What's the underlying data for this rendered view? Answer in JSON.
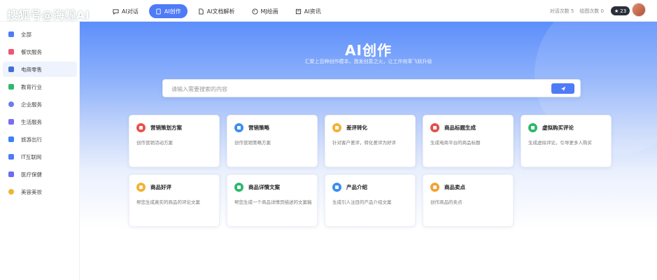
{
  "watermark": "搜狐号@海鲸AI",
  "nav": [
    {
      "label": "AI对话",
      "icon": "chat-bubble-icon"
    },
    {
      "label": "AI创作",
      "icon": "create-pad-icon",
      "active": true
    },
    {
      "label": "AI文档解析",
      "icon": "document-icon"
    },
    {
      "label": "MJ绘画",
      "icon": "palette-icon"
    },
    {
      "label": "AI资讯",
      "icon": "news-icon"
    }
  ],
  "counts": {
    "chat": "对话次数 5",
    "draw": "绘图次数 0"
  },
  "badge": "23",
  "sidebar": [
    {
      "label": "全部",
      "color": "#4e7bf6"
    },
    {
      "label": "餐饮服务",
      "color": "#f0546e"
    },
    {
      "label": "电商零售",
      "color": "#3f6fd6",
      "active": true
    },
    {
      "label": "教育行业",
      "color": "#2fb86b"
    },
    {
      "label": "企业服务",
      "color": "#6b7cf0"
    },
    {
      "label": "生活服务",
      "color": "#7a6cf2"
    },
    {
      "label": "旅游出行",
      "color": "#3b82f6"
    },
    {
      "label": "IT互联网",
      "color": "#4e7bf6"
    },
    {
      "label": "医疗保健",
      "color": "#6b6cf0"
    },
    {
      "label": "美容美妆",
      "color": "#f2b233"
    }
  ],
  "hero": {
    "title": "AI创作",
    "subtitle": "汇聚上百种创作模本，激发创意之火，让工作效率飞跃升级"
  },
  "search": {
    "placeholder": "请输入需要搜索的内容"
  },
  "cards": [
    {
      "title": "营销策划方案",
      "desc": "创作营销活动方案",
      "color": "#e8524a"
    },
    {
      "title": "营销策略",
      "desc": "创作营销策略方案",
      "color": "#3b8ff0"
    },
    {
      "title": "差评转化",
      "desc": "针对客户差评，转化差评为好评",
      "color": "#f2b233"
    },
    {
      "title": "商品标题生成",
      "desc": "生成电商平台的商品标题",
      "color": "#e0524a"
    },
    {
      "title": "虚拟购买评论",
      "desc": "生成虚拟评论，引导更多人购买",
      "color": "#2fb86b"
    },
    {
      "title": "商品好评",
      "desc": "帮您生成真实的商品的评论文案",
      "color": "#f2b233"
    },
    {
      "title": "商品详情文案",
      "desc": "帮您生成一个商品详情页描述的文案稿",
      "color": "#2fb86b"
    },
    {
      "title": "产品介绍",
      "desc": "生成引人注目的产品介绍文案",
      "color": "#3b8ff0"
    },
    {
      "title": "商品卖点",
      "desc": "创作商品的卖点",
      "color": "#f2a233"
    }
  ]
}
